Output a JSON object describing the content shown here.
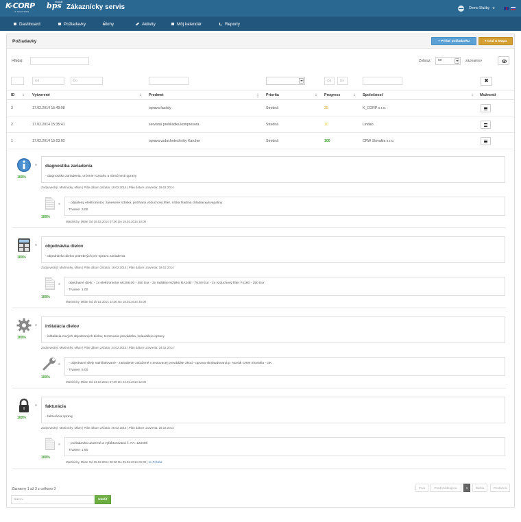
{
  "header": {
    "logo_text": "K-CORP",
    "logo_subtext": "I.T. SOLUTIONS",
    "bps_text": "bps",
    "bps_module": "module",
    "app_title": "Zákaznícky servis",
    "user_name": "Demo Služby",
    "languages": [
      "EN",
      "SK"
    ]
  },
  "nav": {
    "items": [
      {
        "label": "Dashboard",
        "icon": "grid-icon"
      },
      {
        "label": "Požiadavky",
        "icon": "document-icon"
      },
      {
        "label": "Úlohy",
        "icon": "tag-icon"
      },
      {
        "label": "Aktivity",
        "icon": "pencil-icon"
      },
      {
        "label": "Môj kalendár",
        "icon": "calendar-icon"
      },
      {
        "label": "Reporty",
        "icon": "bar-chart-icon"
      }
    ]
  },
  "panel": {
    "title": "Požiadavky",
    "add_button": "+ Pridať požiadavku",
    "chart_button": "♦ Graf & Mapa",
    "search_label": "Hľadaj:",
    "show_label": "Zobraz:",
    "show_value": "50",
    "records_label": "záznamov",
    "filters": {
      "from_placeholder": "Od",
      "to_placeholder": "Do"
    }
  },
  "table": {
    "columns": [
      "ID",
      "Vytvorené",
      "Predmet",
      "Priorita",
      "Progress",
      "Spoločnosť",
      "Možnosti"
    ],
    "rows": [
      {
        "id": "3",
        "created": "17.02.2014 15:49:08",
        "subject": "oprava fasády",
        "priority": "Stredná",
        "progress": "25",
        "progress_color": "#e8a21a",
        "company": "K_CORP s.r.o."
      },
      {
        "id": "2",
        "created": "17.02.2014 15:35:41",
        "subject": "servisná prehliadka kompresora",
        "priority": "Stredná",
        "progress": "10",
        "progress_color": "#e8d01a",
        "company": "Lindab"
      },
      {
        "id": "1",
        "created": "17.02.2014 15:03:02",
        "subject": "oprava vzduchotechniky Karcher",
        "priority": "Stredná",
        "progress": "100",
        "progress_color": "#3a9a2c",
        "company": "CRW Slovakia s.r.o."
      }
    ]
  },
  "activities": [
    {
      "icon": "info-icon",
      "percent": "100%",
      "title": "diagnostika zariadenia",
      "description": "- diagnostika zariadenia, určenie rozsahu a náročnosti opravy",
      "meta": "Zodpovedný: Martinicky, Milan | Plán dátum začatia: 19.02.2014 | Plán dátum uzavretia: 19.02.2014",
      "sub_percent": "100%",
      "sub_text": "- odpálený elektromotor, zanesené ložiská, potrhaný vzduchový filter, nízka hladina chladiacej kvapaliny",
      "sub_duration": "Trvanie: 3.00",
      "sub_meta": "Martinicky, Milan Od 19.02.2014 07:00 Do 19.02.2014 10:00",
      "sub_link": ""
    },
    {
      "icon": "calculator-icon",
      "percent": "100%",
      "title": "objednávka dielov",
      "description": "- objednávka dielov potrebných pre opravu zariadenia",
      "meta": "Zodpovedný: Martinicky, Milan | Plán dátum začatia: 19.02.2014 | Plán dátum uzavretia: 19.02.2014",
      "sub_percent": "100%",
      "sub_text": "objednané diely: \\n- 1x elektromotor AK256.00 - 450 Eur\\n- 2x radiálne ložisko RA24B - 75,50 Eur\\n- 2x vzduchový filter Fx160 - 250 Eur",
      "sub_duration": "Trvanie: 1.00",
      "sub_meta": "Martinicky, Milan Od 19.02.2014 14:00 Do 19.02.2014 15:00",
      "sub_link": ""
    },
    {
      "icon": "gear-icon",
      "percent": "100%",
      "title": "inštalácia dielov",
      "description": "- inštalácia nových objednaných dielov, testovacia prevádzka, kolaudácia opravy",
      "meta": "Zodpovedný: Martinicky, Milan | Plán dátum začatia: 24.02.2014 | Plán dátum uzavretia: 24.02.2014",
      "sub_percent": "100%",
      "sub_text": "- objednané diely nainštalované\\n- zariadenie zaťažené v testovacej prevádzke 3hod\\n- oprava skolaudovaná p. Novák CRW Slovakia - OK",
      "sub_duration": "Trvanie: 5.00",
      "sub_meta": "Martinicky, Milan Od 24.02.2014 07:00 Do 24.02.2014 12:00",
      "sub_link": ""
    },
    {
      "icon": "lock-icon",
      "percent": "100%",
      "title": "fakturácia",
      "description": "- fakturácia opravy",
      "meta": "Zodpovedný: Martinicky, Milan | Plán dátum začatia: 25.02.2014 | Plán dátum uzavretia: 25.02.2014",
      "sub_percent": "100%",
      "sub_text": "- požiadavka uzavretá a vyfakturovaná č. FA: 123456",
      "sub_duration": "Trvanie: 1.50",
      "sub_meta": "Martinicky, Milan Od 25.02.2014 08:00 Do 25.02.2014 09:30 | ",
      "sub_link": "1x Príloha"
    }
  ],
  "footer": {
    "records_info": "Záznamy 1 až 3 z celkovo 3",
    "pager": [
      "Prvá",
      "Predchádzajúca",
      "1",
      "Ďalšia",
      "Posledná"
    ],
    "name_placeholder": "Názov",
    "ok_button": "Uložiť"
  }
}
